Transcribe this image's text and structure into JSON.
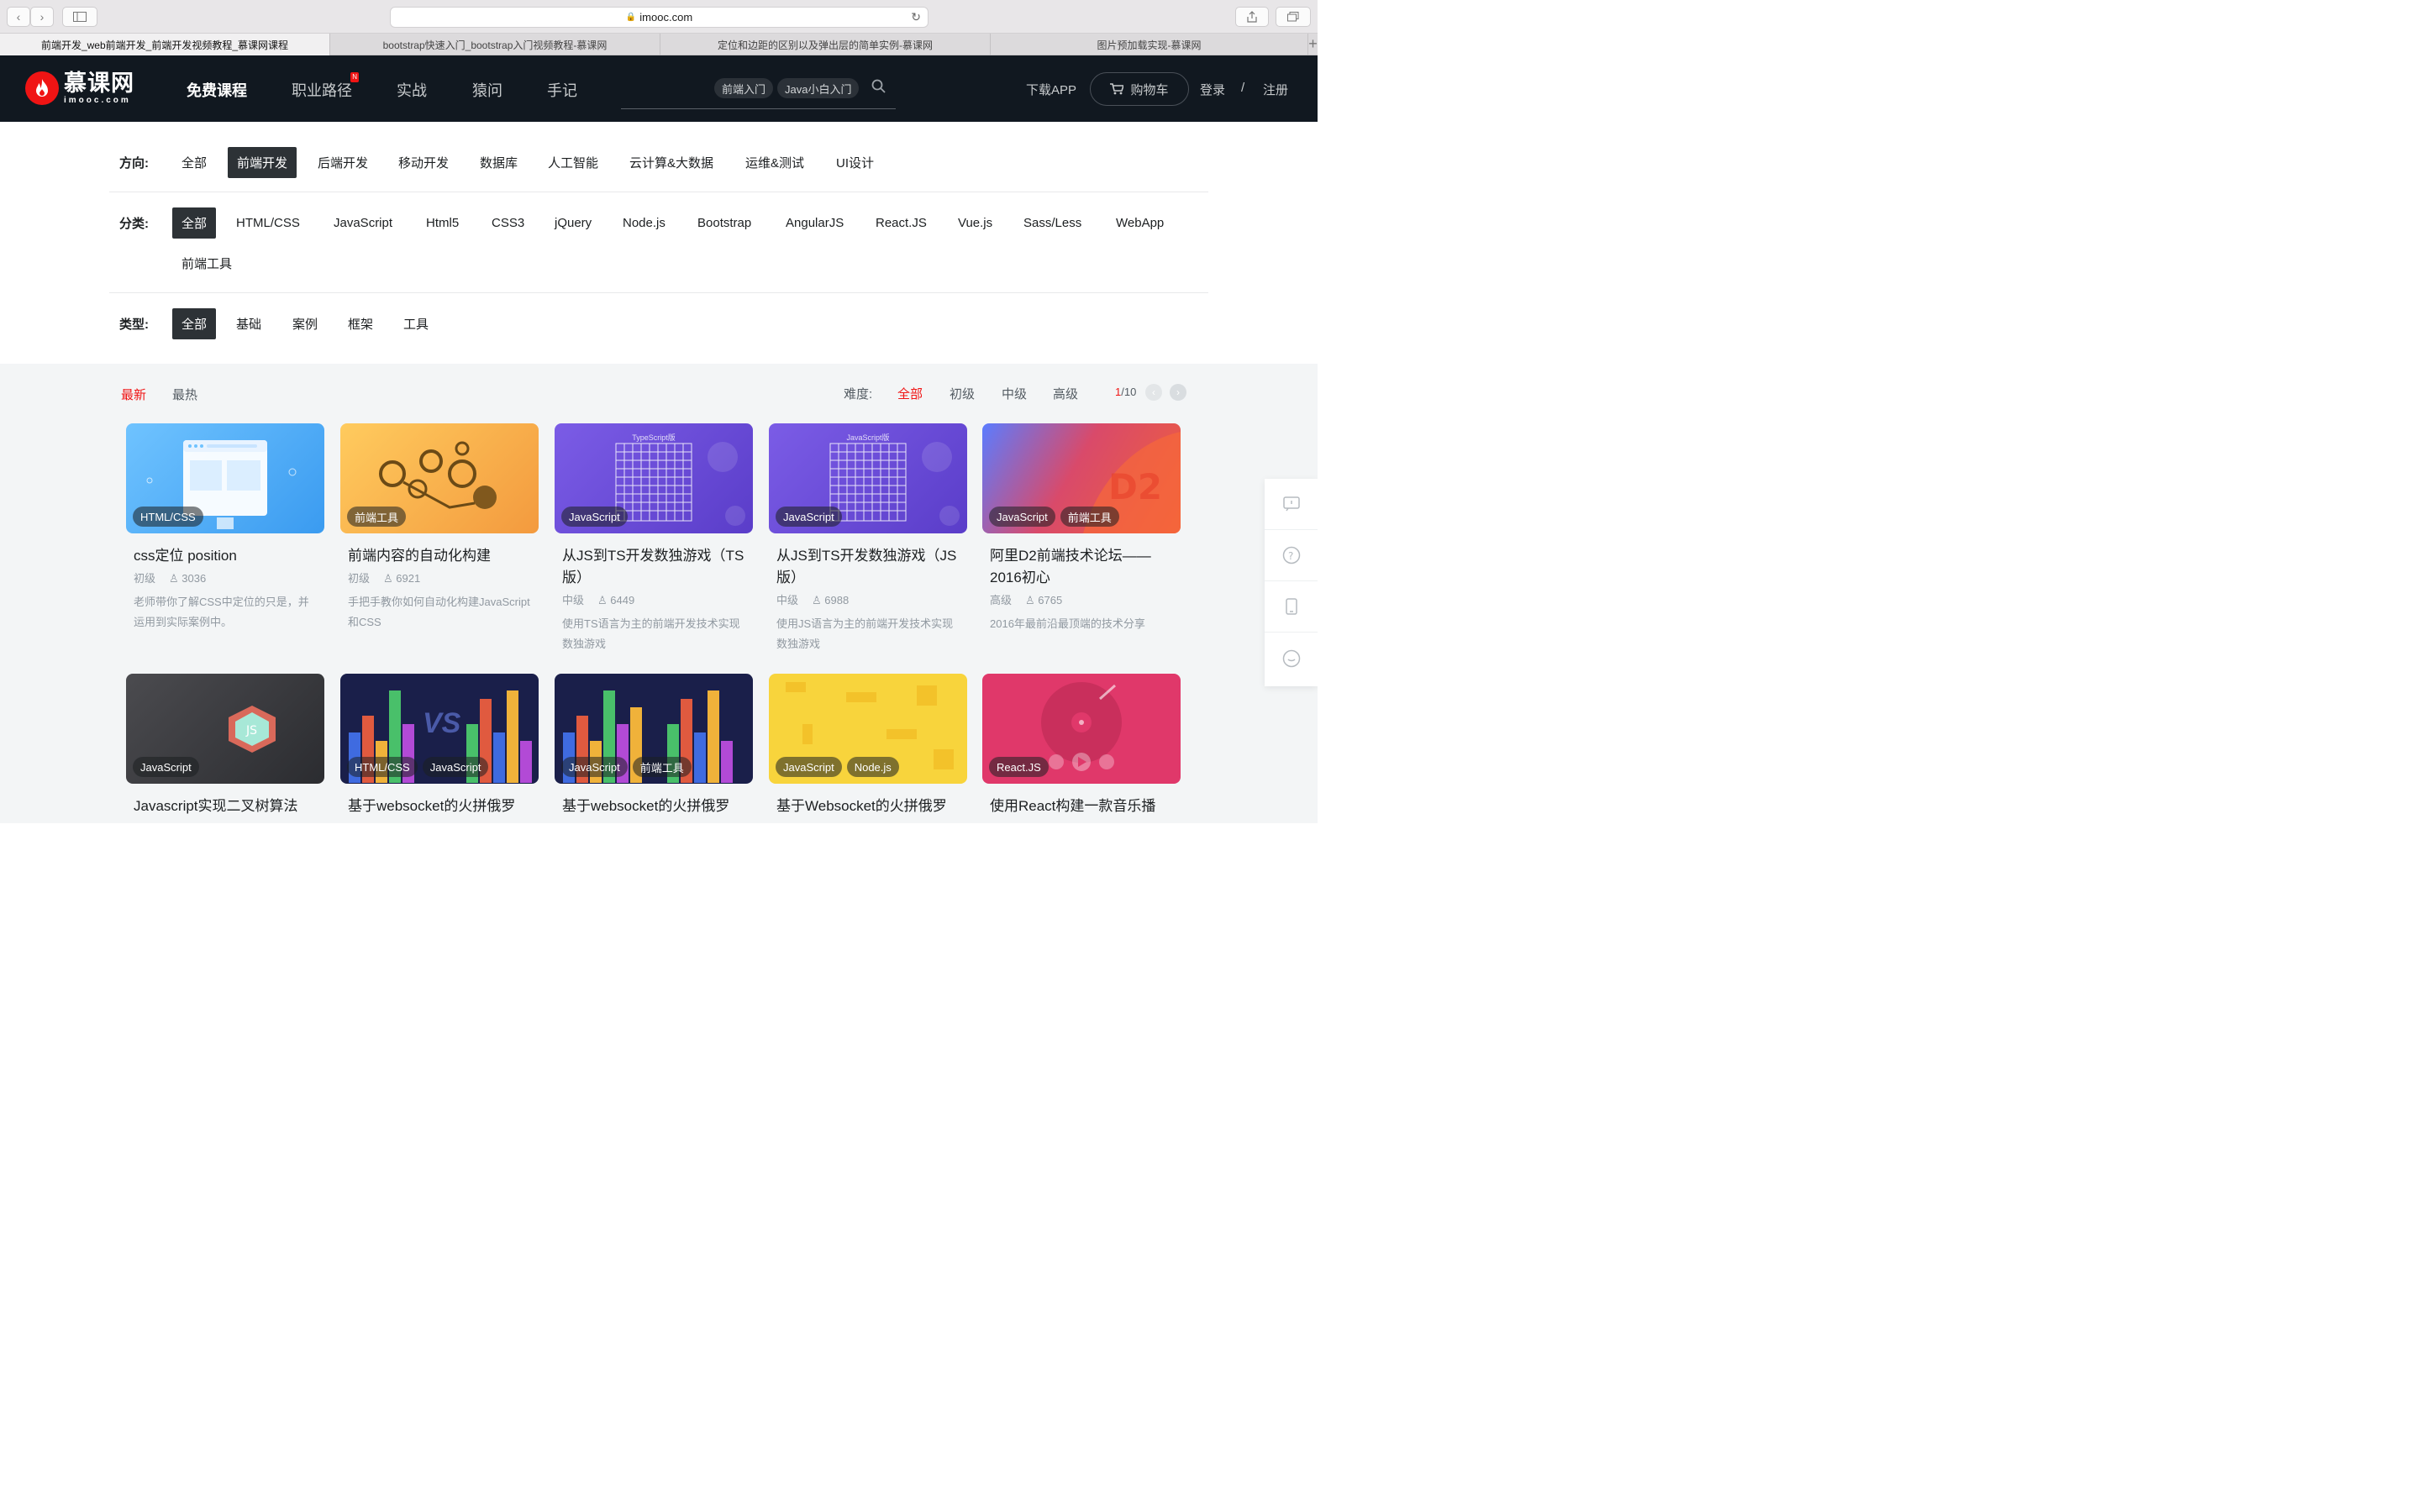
{
  "browser": {
    "url": "imooc.com",
    "tabs": [
      "前端开发_web前端开发_前端开发视频教程_慕课网课程",
      "bootstrap快速入门_bootstrap入门视频教程-慕课网",
      "定位和边距的区别以及弹出层的简单实例-慕课网",
      "图片预加载实现-慕课网"
    ]
  },
  "header": {
    "logo_cn": "慕课网",
    "logo_en": "imooc.com",
    "nav": [
      "免费课程",
      "职业路径",
      "实战",
      "猿问",
      "手记"
    ],
    "nav_badge": "N",
    "search_tags": [
      "前端入门",
      "Java小白入门"
    ],
    "download": "下载APP",
    "cart": "购物车",
    "login": "登录",
    "slash": "/",
    "register": "注册"
  },
  "filters": {
    "direction_label": "方向:",
    "directions": [
      "全部",
      "前端开发",
      "后端开发",
      "移动开发",
      "数据库",
      "人工智能",
      "云计算&大数据",
      "运维&测试",
      "UI设计"
    ],
    "category_label": "分类:",
    "categories": [
      "全部",
      "HTML/CSS",
      "JavaScript",
      "Html5",
      "CSS3",
      "jQuery",
      "Node.js",
      "Bootstrap",
      "AngularJS",
      "React.JS",
      "Vue.js",
      "Sass/Less",
      "WebApp",
      "前端工具"
    ],
    "type_label": "类型:",
    "types": [
      "全部",
      "基础",
      "案例",
      "框架",
      "工具"
    ]
  },
  "sort": {
    "newest": "最新",
    "hottest": "最热",
    "difficulty_label": "难度:",
    "levels": [
      "全部",
      "初级",
      "中级",
      "高级"
    ],
    "page_current": "1",
    "page_total": "/10"
  },
  "courses": [
    {
      "title": "css定位 position",
      "level": "初级",
      "learners": "3036",
      "desc": "老师带你了解CSS中定位的只是，并运用到实际案例中。",
      "tags": [
        "HTML/CSS"
      ]
    },
    {
      "title": "前端内容的自动化构建",
      "level": "初级",
      "learners": "6921",
      "desc": "手把手教你如何自动化构建JavaScript和CSS",
      "tags": [
        "前端工具"
      ]
    },
    {
      "title": "从JS到TS开发数独游戏（TS版）",
      "level": "中级",
      "learners": "6449",
      "desc": "使用TS语言为主的前端开发技术实现数独游戏",
      "tags": [
        "JavaScript"
      ],
      "thumb_caption": "TypeScript版"
    },
    {
      "title": "从JS到TS开发数独游戏（JS版）",
      "level": "中级",
      "learners": "6988",
      "desc": "使用JS语言为主的前端开发技术实现数独游戏",
      "tags": [
        "JavaScript"
      ],
      "thumb_caption": "JavaScript版"
    },
    {
      "title": "阿里D2前端技术论坛——2016初心",
      "level": "高级",
      "learners": "6765",
      "desc": "2016年最前沿最顶端的技术分享",
      "tags": [
        "JavaScript",
        "前端工具"
      ]
    },
    {
      "title": "Javascript实现二叉树算法",
      "tags": [
        "JavaScript"
      ]
    },
    {
      "title": "基于websocket的火拼俄罗",
      "tags": [
        "HTML/CSS",
        "JavaScript"
      ],
      "thumb_caption": "VS"
    },
    {
      "title": "基于websocket的火拼俄罗",
      "tags": [
        "JavaScript",
        "前端工具"
      ]
    },
    {
      "title": "基于Websocket的火拼俄罗",
      "tags": [
        "JavaScript",
        "Node.js"
      ]
    },
    {
      "title": "使用React构建一款音乐播",
      "tags": [
        "React.JS"
      ]
    }
  ],
  "colors": {
    "accent": "#f01414",
    "header_bg": "#111820",
    "content_bg": "#f3f5f6"
  }
}
